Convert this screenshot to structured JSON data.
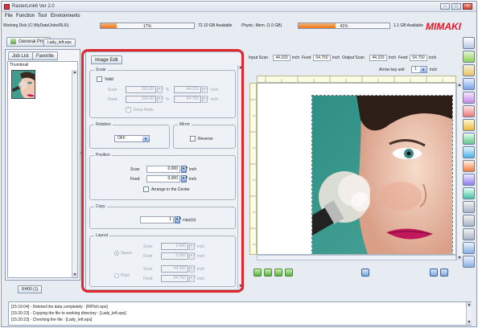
{
  "window": {
    "title": "RasterLink6 Ver 2.0",
    "controls": [
      "minimize",
      "maximize",
      "close"
    ]
  },
  "menu": [
    "File",
    "Function",
    "Tool",
    "Environments"
  ],
  "status": {
    "working_disk": "Working Disk (C:\\MyData\\Jobs\\RL6\\)",
    "disk_percent": 17,
    "disk_percent_label": "17%",
    "disk_available": "72.10 GB Available",
    "phys_mem": "Physic. Mem. (1.0 GB)",
    "mem_percent": 41,
    "mem_percent_label": "41%",
    "mem_available": "1.1 GB Available",
    "brand": "MIMAKI",
    "accent": "#e8731a",
    "brand_color": "#e01726"
  },
  "doc_tabs": [
    {
      "label": "General Print"
    },
    {
      "label": "Lady_left.eps"
    }
  ],
  "left_panel": {
    "tabs": [
      "Job List",
      "Favorite"
    ],
    "thumbnail_label": "Thumbnail"
  },
  "edit_panel": {
    "tab": "Image Edit",
    "scale": {
      "title": "Scale",
      "valid_label": "Valid",
      "scan_label": "Scan",
      "scan_pct": "100.00",
      "scan_inch": "44.333",
      "feed_label": "Feed",
      "feed_pct": "100.00",
      "feed_inch": "54.750",
      "pct_unit": "%",
      "inch_unit": "inch",
      "keep_ratio": "Keep Ratio"
    },
    "rotation": {
      "title": "Rotation",
      "value": "OFF"
    },
    "mirror": {
      "title": "Mirror",
      "reverse": "Reverse"
    },
    "position": {
      "title": "Position",
      "scan_label": "Scan",
      "scan_value": "0.000",
      "feed_label": "Feed",
      "feed_value": "0.000",
      "unit": "inch",
      "arrange": "Arrange in the Center"
    },
    "copy": {
      "title": "Copy",
      "value": "1",
      "unit": "copy(s)"
    },
    "layout": {
      "title": "Layout",
      "space_label": "Space",
      "pitch_label": "Pitch",
      "space_scan": "0.000",
      "space_feed": "0.000",
      "pitch_scan": "44.333",
      "pitch_feed": "54.750",
      "scan_label": "Scan",
      "feed_label": "Feed",
      "unit": "inch"
    }
  },
  "canvas": {
    "input_label": "Input Scan",
    "input_scan": "44.333",
    "inch1": "inch",
    "feed_label": "Feed",
    "input_feed": "54.750",
    "inch2": "inch",
    "output_label": "Output Scan",
    "output_scan": "44.333",
    "inch3": "inch",
    "feed_label2": "Feed",
    "output_feed": "54.750",
    "inch4": "inch",
    "arrow_key_label": "Arrow key unit",
    "arrow_key_value": "1",
    "arrow_unit": "inch"
  },
  "bottom_tab": "RH00 (1)",
  "log": [
    "[15:16:04] - Deleted the data completely : [RIPlch.eps]",
    "[15:20:23] - Copying the file to working directory : [Lady_left.eps]",
    "[15:20:23] - Checking the file : [Lady_left.eps]"
  ]
}
